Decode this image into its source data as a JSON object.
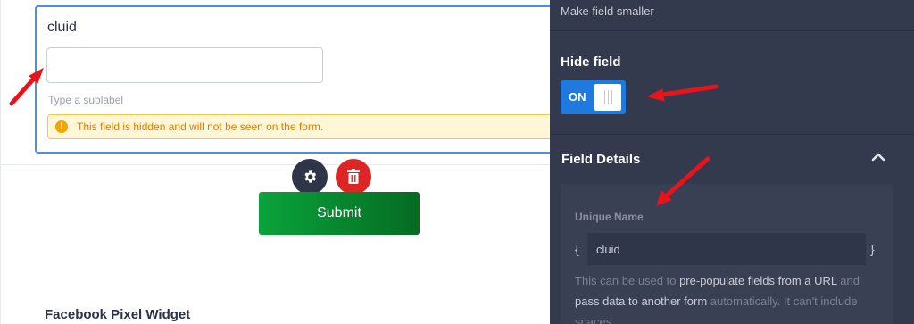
{
  "field": {
    "label": "cluid",
    "input_value": "",
    "sublabel_placeholder": "Type a sublabel",
    "hidden_notice": "This field is hidden and will not be seen on the form."
  },
  "actions": {
    "gear_icon": "gear-icon",
    "trash_icon": "trash-icon"
  },
  "form": {
    "submit_label": "Submit",
    "next_widget_title": "Facebook Pixel Widget"
  },
  "panel": {
    "make_smaller_label": "Make field smaller",
    "hide_field": {
      "title": "Hide field",
      "toggle_state": "ON"
    },
    "field_details": {
      "title": "Field Details",
      "unique_name_label": "Unique Name",
      "brace_open": "{",
      "brace_close": "}",
      "unique_name_value": "cluid",
      "help_part1": "This can be used to ",
      "help_bold1": "pre-populate fields from a URL",
      "help_part2": " and ",
      "help_bold2": "pass data to another form",
      "help_part3": " automatically. It can't include spaces."
    }
  },
  "colors": {
    "accent_blue": "#1f7ae0",
    "panel_bg": "#343a4d",
    "submit_green": "#0aa33b",
    "delete_red": "#dc2626",
    "annotation_red": "#e8131b"
  }
}
